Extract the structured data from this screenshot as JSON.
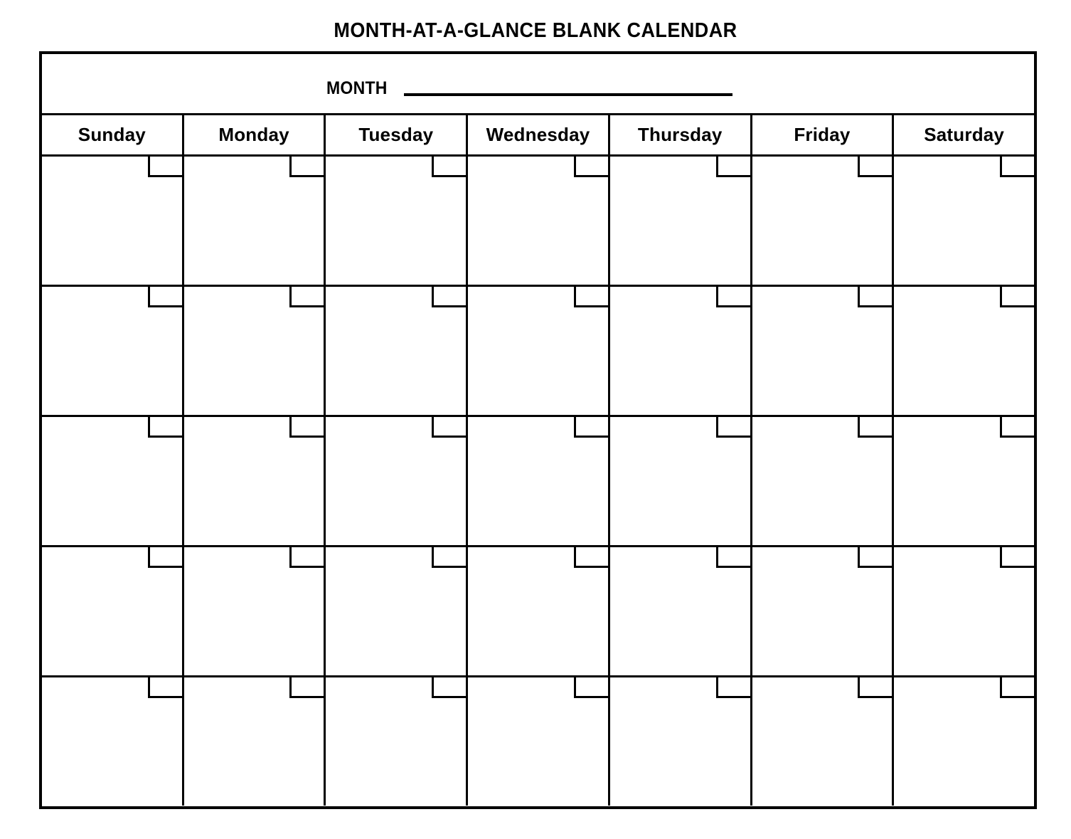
{
  "document": {
    "title": "MONTH-AT-A-GLANCE  BLANK  CALENDAR"
  },
  "month_field": {
    "label": "MONTH",
    "value": "",
    "placeholder": ""
  },
  "weekdays": [
    {
      "label": "Sunday"
    },
    {
      "label": "Monday"
    },
    {
      "label": "Tuesday"
    },
    {
      "label": "Wednesday"
    },
    {
      "label": "Thursday"
    },
    {
      "label": "Friday"
    },
    {
      "label": "Saturday"
    }
  ],
  "weeks": [
    {
      "days": [
        {
          "date": ""
        },
        {
          "date": ""
        },
        {
          "date": ""
        },
        {
          "date": ""
        },
        {
          "date": ""
        },
        {
          "date": ""
        },
        {
          "date": ""
        }
      ]
    },
    {
      "days": [
        {
          "date": ""
        },
        {
          "date": ""
        },
        {
          "date": ""
        },
        {
          "date": ""
        },
        {
          "date": ""
        },
        {
          "date": ""
        },
        {
          "date": ""
        }
      ]
    },
    {
      "days": [
        {
          "date": ""
        },
        {
          "date": ""
        },
        {
          "date": ""
        },
        {
          "date": ""
        },
        {
          "date": ""
        },
        {
          "date": ""
        },
        {
          "date": ""
        }
      ]
    },
    {
      "days": [
        {
          "date": ""
        },
        {
          "date": ""
        },
        {
          "date": ""
        },
        {
          "date": ""
        },
        {
          "date": ""
        },
        {
          "date": ""
        },
        {
          "date": ""
        }
      ]
    },
    {
      "days": [
        {
          "date": ""
        },
        {
          "date": ""
        },
        {
          "date": ""
        },
        {
          "date": ""
        },
        {
          "date": ""
        },
        {
          "date": ""
        },
        {
          "date": ""
        }
      ]
    }
  ],
  "style": {
    "ink_color": "#000000",
    "paper_color": "#ffffff"
  }
}
